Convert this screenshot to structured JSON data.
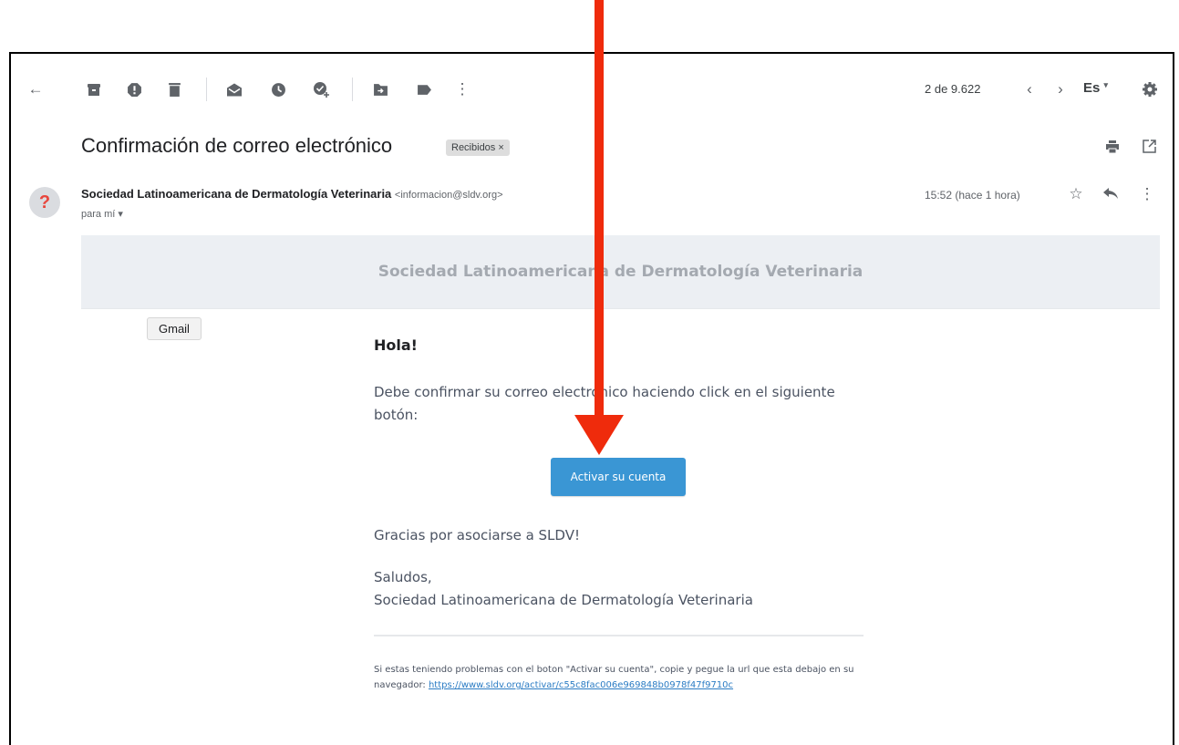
{
  "toolbar": {
    "back_icon": "←",
    "archive_icon": "archive-icon",
    "spam_icon": "report-spam-icon",
    "delete_icon": "trash-icon",
    "mark_unread_icon": "envelope-open-icon",
    "snooze_icon": "clock-icon",
    "add_task_icon": "add-task-icon",
    "move_icon": "folder-move-icon",
    "label_icon": "label-icon",
    "more_icon": "⋮",
    "pagination": "2 de 9.622",
    "prev_icon": "‹",
    "next_icon": "›",
    "language": "Es",
    "settings_icon": "gear-icon"
  },
  "email": {
    "subject": "Confirmación de correo electrónico",
    "label": "Recibidos ×",
    "avatar_text": "?",
    "sender_name": "Sociedad Latinoamericana de Dermatología Veterinaria",
    "sender_email": "<informacion@sldv.org>",
    "recipient": "para mí ▾",
    "time": "15:52 (hace 1 hora)"
  },
  "body": {
    "banner_title": "Sociedad Latinoamericana de Dermatología Veterinaria",
    "tooltip": "Gmail",
    "greeting": "Hola!",
    "instruction": "Debe confirmar su correo electrónico haciendo click en el siguiente botón:",
    "button_label": "Activar su cuenta",
    "thanks": "Gracias por asociarse a SLDV!",
    "sign_off": "Saludos,",
    "signature": "Sociedad Latinoamericana de Dermatología Veterinaria",
    "footnote": "Si estas teniendo problemas con el boton \"Activar su cuenta\", copie y pegue la url que esta debajo en su navegador: ",
    "activation_url": "https://www.sldv.org/activar/c55c8fac006e969848b0978f47f9710c"
  },
  "colors": {
    "arrow": "#ef2b0c",
    "button": "#3a96d4",
    "link": "#2b7cc4",
    "banner_bg": "#eceff3"
  }
}
